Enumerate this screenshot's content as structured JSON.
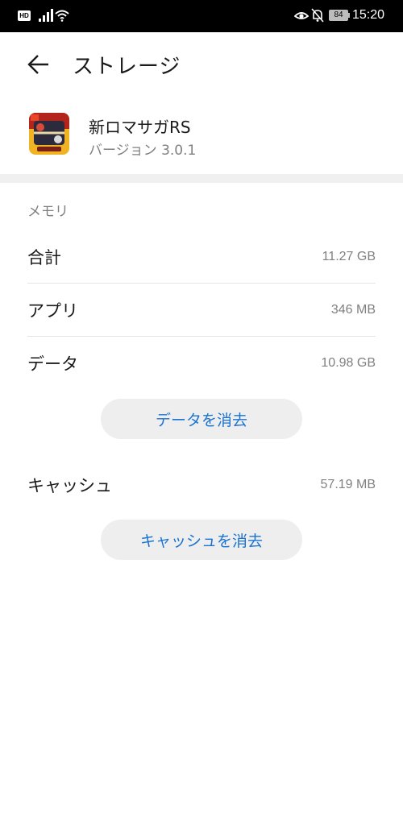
{
  "status_bar": {
    "hd_label": "HD",
    "battery_level": "84",
    "time": "15:20"
  },
  "header": {
    "title": "ストレージ"
  },
  "app": {
    "name": "新ロマサガRS",
    "version": "バージョン 3.0.1"
  },
  "memory": {
    "section_label": "メモリ",
    "rows": [
      {
        "label": "合計",
        "value": "11.27 GB"
      },
      {
        "label": "アプリ",
        "value": "346 MB"
      },
      {
        "label": "データ",
        "value": "10.98 GB"
      }
    ],
    "clear_data_label": "データを消去"
  },
  "cache": {
    "label": "キャッシュ",
    "value": "57.19 MB",
    "clear_cache_label": "キャッシュを消去"
  },
  "colors": {
    "accent": "#1a73d1",
    "status_bar_bg": "#000000",
    "button_bg": "#eeeeee",
    "secondary_text": "#808080"
  }
}
